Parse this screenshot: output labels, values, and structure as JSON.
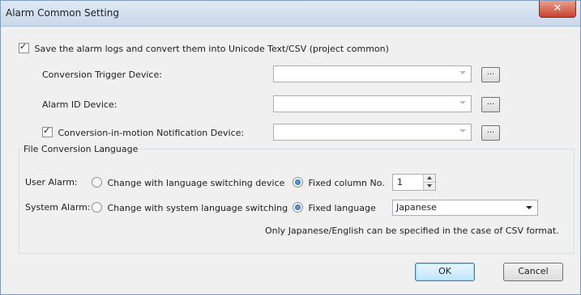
{
  "window": {
    "title": "Alarm Common Setting"
  },
  "save_logs": {
    "checked": true,
    "label": "Save the alarm logs and convert them into Unicode Text/CSV (project common)"
  },
  "fields": {
    "trigger": {
      "label": "Conversion Trigger Device:",
      "value": ""
    },
    "alarm_id": {
      "label": "Alarm ID Device:",
      "value": ""
    },
    "notification": {
      "checked": true,
      "label": "Conversion-in-motion Notification Device:",
      "value": ""
    },
    "browse_label": "..."
  },
  "language_group": {
    "title": "File Conversion Language",
    "user_alarm": {
      "label": "User Alarm:",
      "option_switching": "Change with language switching device",
      "option_fixed": "Fixed column No.",
      "selected": "fixed",
      "column_no": "1"
    },
    "system_alarm": {
      "label": "System Alarm:",
      "option_switching": "Change with system language switching",
      "option_fixed": "Fixed language",
      "selected": "fixed",
      "language": "Japanese"
    },
    "note": "Only Japanese/English can be specified in the case of  CSV format."
  },
  "buttons": {
    "ok": "OK",
    "cancel": "Cancel"
  },
  "colors": {
    "title_bar": "#dbe6f4",
    "close_button": "#c9432e",
    "radio_selected": "#1c5fab"
  }
}
